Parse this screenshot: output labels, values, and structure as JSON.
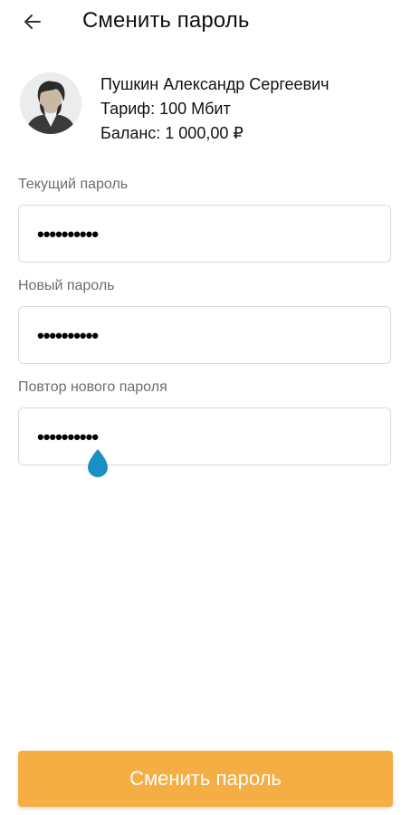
{
  "header": {
    "title": "Сменить пароль"
  },
  "profile": {
    "name": "Пушкин Александр Сергеевич",
    "tariff": "Тариф: 100 Мбит",
    "balance": "Баланс: 1 000,00 ₽"
  },
  "form": {
    "current_password": {
      "label": "Текущий пароль",
      "value_masked": "••••••••••"
    },
    "new_password": {
      "label": "Новый пароль",
      "value_masked": "••••••••••"
    },
    "repeat_password": {
      "label": "Повтор нового пароля",
      "value_masked": "••••••••••"
    }
  },
  "submit_label": "Сменить пароль",
  "colors": {
    "accent": "#f4ae44",
    "cursor_handle": "#1a8fc4"
  },
  "icons": {
    "back": "arrow-left-icon",
    "cursor": "text-cursor-handle-icon"
  }
}
